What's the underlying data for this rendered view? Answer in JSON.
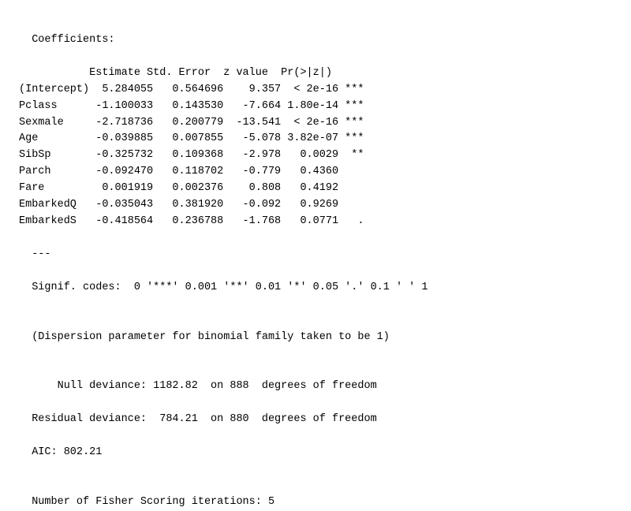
{
  "content": {
    "title": "Coefficients:",
    "header_line": "           Estimate Std. Error  z value  Pr(>|z|)    ",
    "rows": [
      "(Intercept)  5.284055   0.564696    9.357  < 2e-16 ***",
      "Pclass      -1.100033   0.143530   -7.664 1.80e-14 ***",
      "Sexmale     -2.718736   0.200779  -13.541  < 2e-16 ***",
      "Age         -0.039885   0.007855   -5.078 3.82e-07 ***",
      "SibSp       -0.325732   0.109368   -2.978   0.0029  **",
      "Parch       -0.092470   0.118702   -0.779   0.4360    ",
      "Fare         0.001919   0.002376    0.808   0.4192    ",
      "EmbarkedQ   -0.035043   0.381920   -0.092   0.9269    ",
      "EmbarkedS   -0.418564   0.236788   -1.768   0.0771   ."
    ],
    "separator": "---",
    "signif_line": "Signif. codes:  0 '***' 0.001 '**' 0.01 '*' 0.05 '.' 0.1 ' ' 1",
    "blank1": "",
    "dispersion_line": "(Dispersion parameter for binomial family taken to be 1)",
    "blank2": "",
    "null_deviance": "    Null deviance: 1182.82  on 888  degrees of freedom",
    "residual_deviance": "Residual deviance:  784.21  on 880  degrees of freedom",
    "aic": "AIC: 802.21",
    "blank3": "",
    "fisher": "Number of Fisher Scoring iterations: 5"
  }
}
